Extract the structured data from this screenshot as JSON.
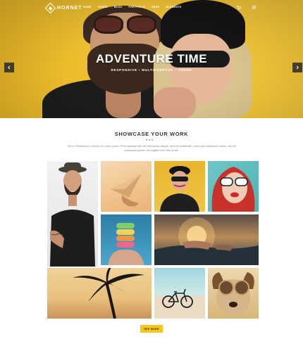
{
  "brand": {
    "name": "HORNET",
    "accent": "#f4c51c"
  },
  "nav": {
    "items": [
      "HOME",
      "PAGES",
      "BLOG",
      "PORTFOLIO",
      "SHOP",
      "ELEMENTS"
    ],
    "icons": [
      "cart-icon",
      "menu-icon"
    ]
  },
  "hero": {
    "title": "ADVENTURE TIME",
    "subtitle": "RESPONSIVE • MULTIPURPOSE • THEME",
    "prev_icon": "chevron-left-icon",
    "next_icon": "chevron-right-icon"
  },
  "showcase": {
    "title": "SHOWCASE YOUR WORK",
    "description": "This is Photoshop's version of Lorem Ipsum. Proin gravida nibh vel velit auctor aliquet. Aenean sollicitudin, lorem quis bibendum auctor, nisi elit consequat ipsum, nec sagittis sem nibh id elit.",
    "button_label": "SEE MORE"
  }
}
